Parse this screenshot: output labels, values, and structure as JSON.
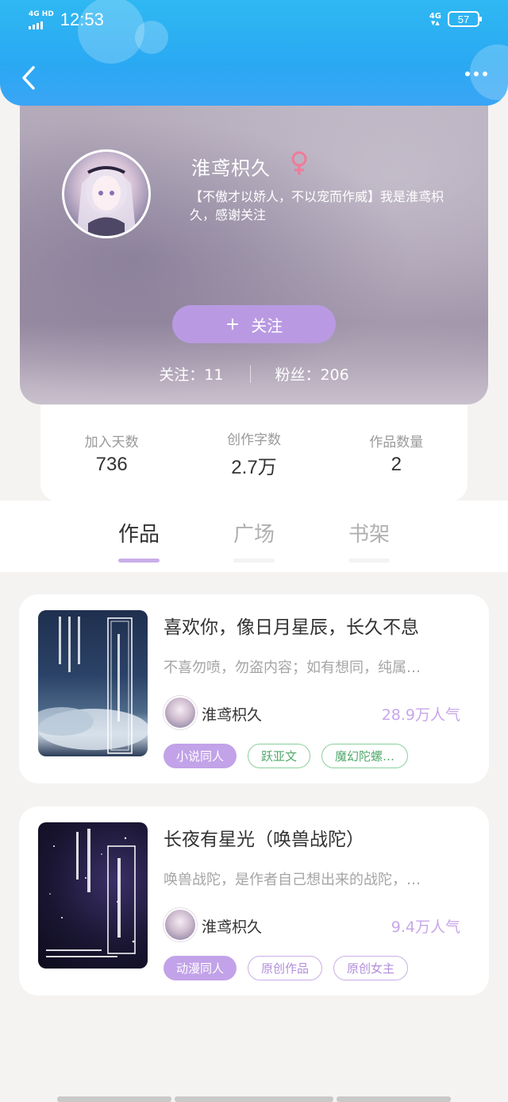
{
  "status_bar": {
    "network": "4G HD",
    "time": "12:53",
    "network_right": "4G",
    "battery": "57"
  },
  "profile": {
    "name": "淮鸢枳久",
    "gender": "female",
    "bio": "【不傲才以娇人，不以宠而作威】我是淮鸢枳久，感谢关注",
    "follow_button": "关注",
    "following_label": "关注：11",
    "fans_label": "粉丝：206"
  },
  "counts": [
    {
      "label": "加入天数",
      "value": "736"
    },
    {
      "label": "创作字数",
      "value": "2.7万"
    },
    {
      "label": "作品数量",
      "value": "2"
    }
  ],
  "tabs": [
    {
      "label": "作品",
      "active": true
    },
    {
      "label": "广场",
      "active": false
    },
    {
      "label": "书架",
      "active": false
    }
  ],
  "books": [
    {
      "title": "喜欢你，像日月星辰，长久不息",
      "description": "不喜勿喷，勿盗内容；如有想同，纯属…",
      "author": "淮鸢枳久",
      "popularity": "28.9万人气",
      "tags": [
        {
          "label": "小说同人",
          "style": "fill"
        },
        {
          "label": "跃亚文",
          "style": "green"
        },
        {
          "label": "魔幻陀螺…",
          "style": "green"
        }
      ]
    },
    {
      "title": "长夜有星光（唤兽战陀）",
      "description": "唤兽战陀，是作者自己想出来的战陀，…",
      "author": "淮鸢枳久",
      "popularity": "9.4万人气",
      "tags": [
        {
          "label": "动漫同人",
          "style": "fill"
        },
        {
          "label": "原创作品",
          "style": "purple"
        },
        {
          "label": "原创女主",
          "style": "purple"
        }
      ]
    }
  ],
  "colors": {
    "header": "#2fb8f2",
    "accent": "#b99ae2",
    "popularity": "#c7a7ea"
  }
}
